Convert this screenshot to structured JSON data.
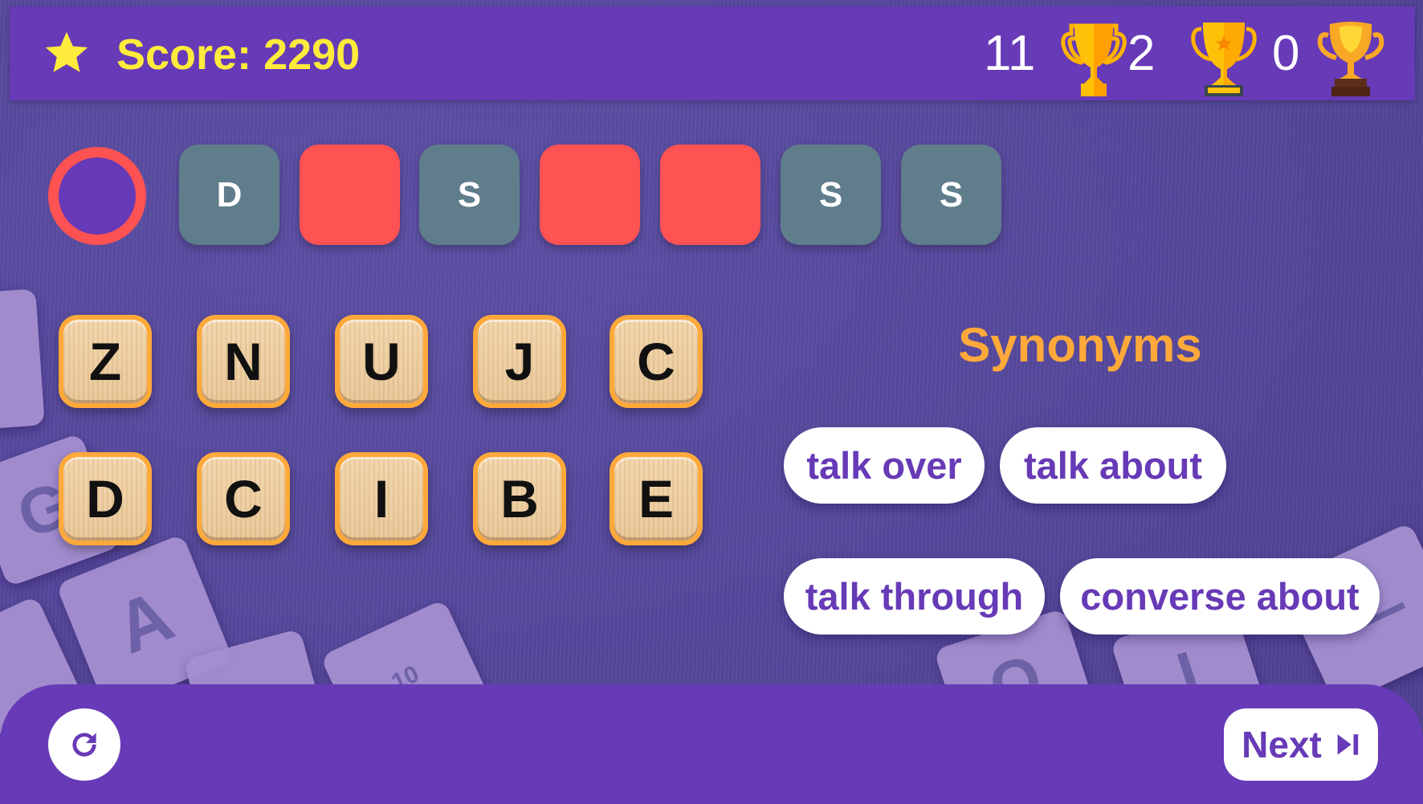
{
  "header": {
    "score_label": "Score: 2290",
    "star_icon": "star-icon",
    "trophies": [
      {
        "count": "11",
        "icon": "trophy-gold-icon"
      },
      {
        "count": "2",
        "icon": "trophy-star-icon"
      },
      {
        "count": "0",
        "icon": "trophy-bronze-icon"
      }
    ]
  },
  "answer": {
    "status_icon": "ring-icon",
    "slots": [
      {
        "letter": "D",
        "state": "filled"
      },
      {
        "letter": "",
        "state": "empty"
      },
      {
        "letter": "S",
        "state": "filled"
      },
      {
        "letter": "",
        "state": "empty"
      },
      {
        "letter": "",
        "state": "empty"
      },
      {
        "letter": "S",
        "state": "filled"
      },
      {
        "letter": "S",
        "state": "filled"
      }
    ]
  },
  "letters": {
    "row1": [
      "Z",
      "N",
      "U",
      "J",
      "C"
    ],
    "row2": [
      "D",
      "C",
      "I",
      "B",
      "E"
    ]
  },
  "hint": {
    "title": "Synonyms",
    "chips": [
      "talk over",
      "talk about",
      "talk through",
      "converse about"
    ]
  },
  "footer": {
    "refresh_icon": "refresh-icon",
    "next_label": "Next",
    "next_icon": "skip-next-icon"
  },
  "colors": {
    "primary": "#673ab7",
    "score": "#ffeb3b",
    "accent": "#ffa93a",
    "slot_filled": "#607d8b",
    "slot_empty": "#ff5252"
  }
}
